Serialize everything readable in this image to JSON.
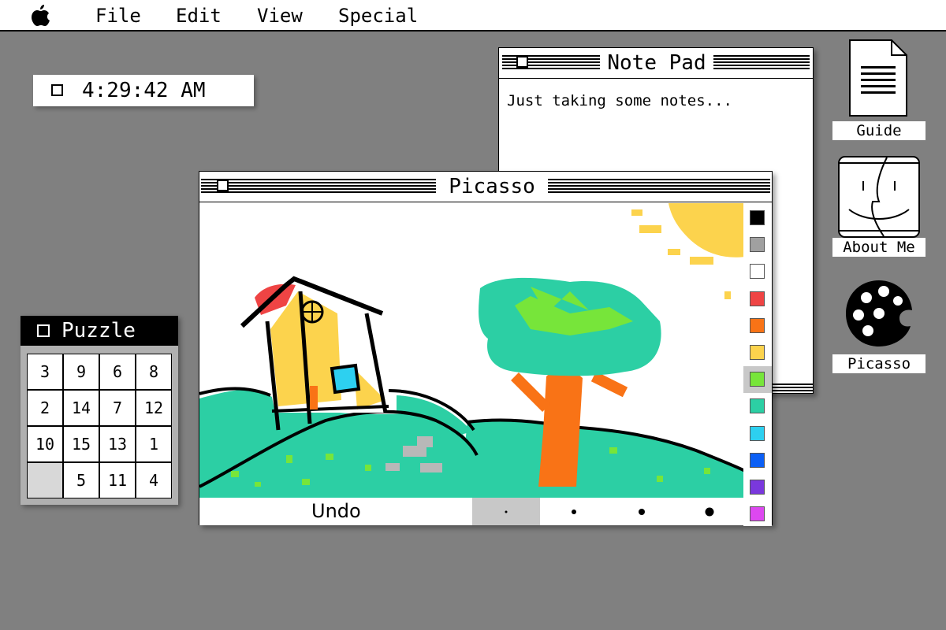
{
  "menubar": {
    "apple_icon": "apple-logo",
    "items": [
      "File",
      "Edit",
      "View",
      "Special"
    ]
  },
  "clock": {
    "time": "4:29:42 AM"
  },
  "notepad": {
    "title": "Note Pad",
    "text": "Just taking some notes..."
  },
  "picasso": {
    "title": "Picasso",
    "undo_label": "Undo",
    "palette": [
      "#000000",
      "#a0a0a0",
      "#ffffff",
      "#ef4444",
      "#f97316",
      "#fcd34d",
      "#77e53a",
      "#2ccfa4",
      "#2dd0f0",
      "#0b5ff5",
      "#7a38dd",
      "#dd48f0"
    ],
    "selected_color": "#77e53a",
    "brush_sizes": [
      "extra-small",
      "small",
      "medium",
      "large"
    ],
    "selected_brush": "extra-small"
  },
  "puzzle": {
    "title": "Puzzle",
    "tiles": [
      "3",
      "9",
      "6",
      "8",
      "2",
      "14",
      "7",
      "12",
      "10",
      "15",
      "13",
      "1",
      "",
      "5",
      "11",
      "4"
    ]
  },
  "desktop_icons": [
    {
      "label": "Guide",
      "icon": "document-icon"
    },
    {
      "label": "About Me",
      "icon": "happy-mac-icon"
    },
    {
      "label": "Picasso",
      "icon": "palette-icon"
    }
  ]
}
